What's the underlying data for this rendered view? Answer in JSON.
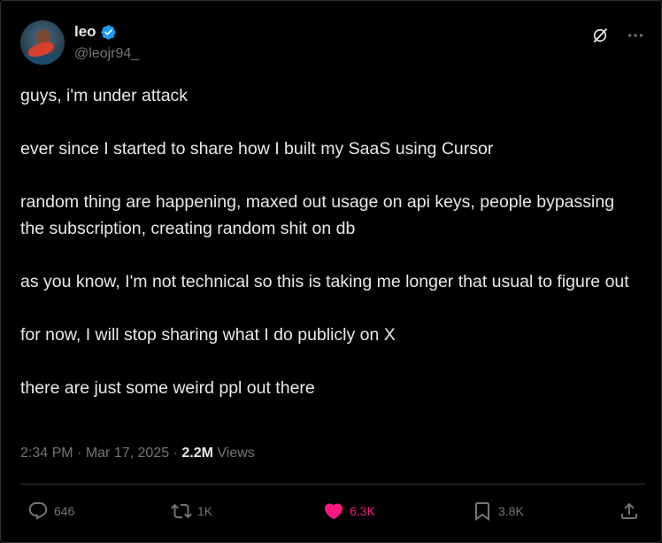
{
  "author": {
    "name": "leo",
    "handle": "@leojr94_"
  },
  "tweet": {
    "paragraphs": [
      "guys, i'm under attack",
      "ever since I started to share how I built my SaaS using Cursor",
      "random thing are happening, maxed out usage on api keys, people bypassing the subscription, creating random shit on db",
      "as you know, I'm not technical so this is taking me longer that usual to figure out",
      "for now, I will stop sharing what I do publicly on X",
      "there are just some weird ppl out there"
    ],
    "time": "2:34 PM",
    "date": "Mar 17, 2025",
    "views_count": "2.2M",
    "views_label": "Views"
  },
  "actions": {
    "replies": "646",
    "reposts": "1K",
    "likes": "6.3K",
    "bookmarks": "3.8K"
  },
  "icons": {
    "verified": "verified-badge-icon",
    "grok": "grok-icon",
    "more": "more-icon",
    "reply": "reply-icon",
    "repost": "repost-icon",
    "like": "heart-icon",
    "bookmark": "bookmark-icon",
    "share": "share-icon"
  },
  "colors": {
    "background": "#000000",
    "text": "#e7e9ea",
    "muted": "#71767b",
    "verified": "#1d9bf0",
    "like": "#f91880",
    "border": "#2f3336"
  }
}
